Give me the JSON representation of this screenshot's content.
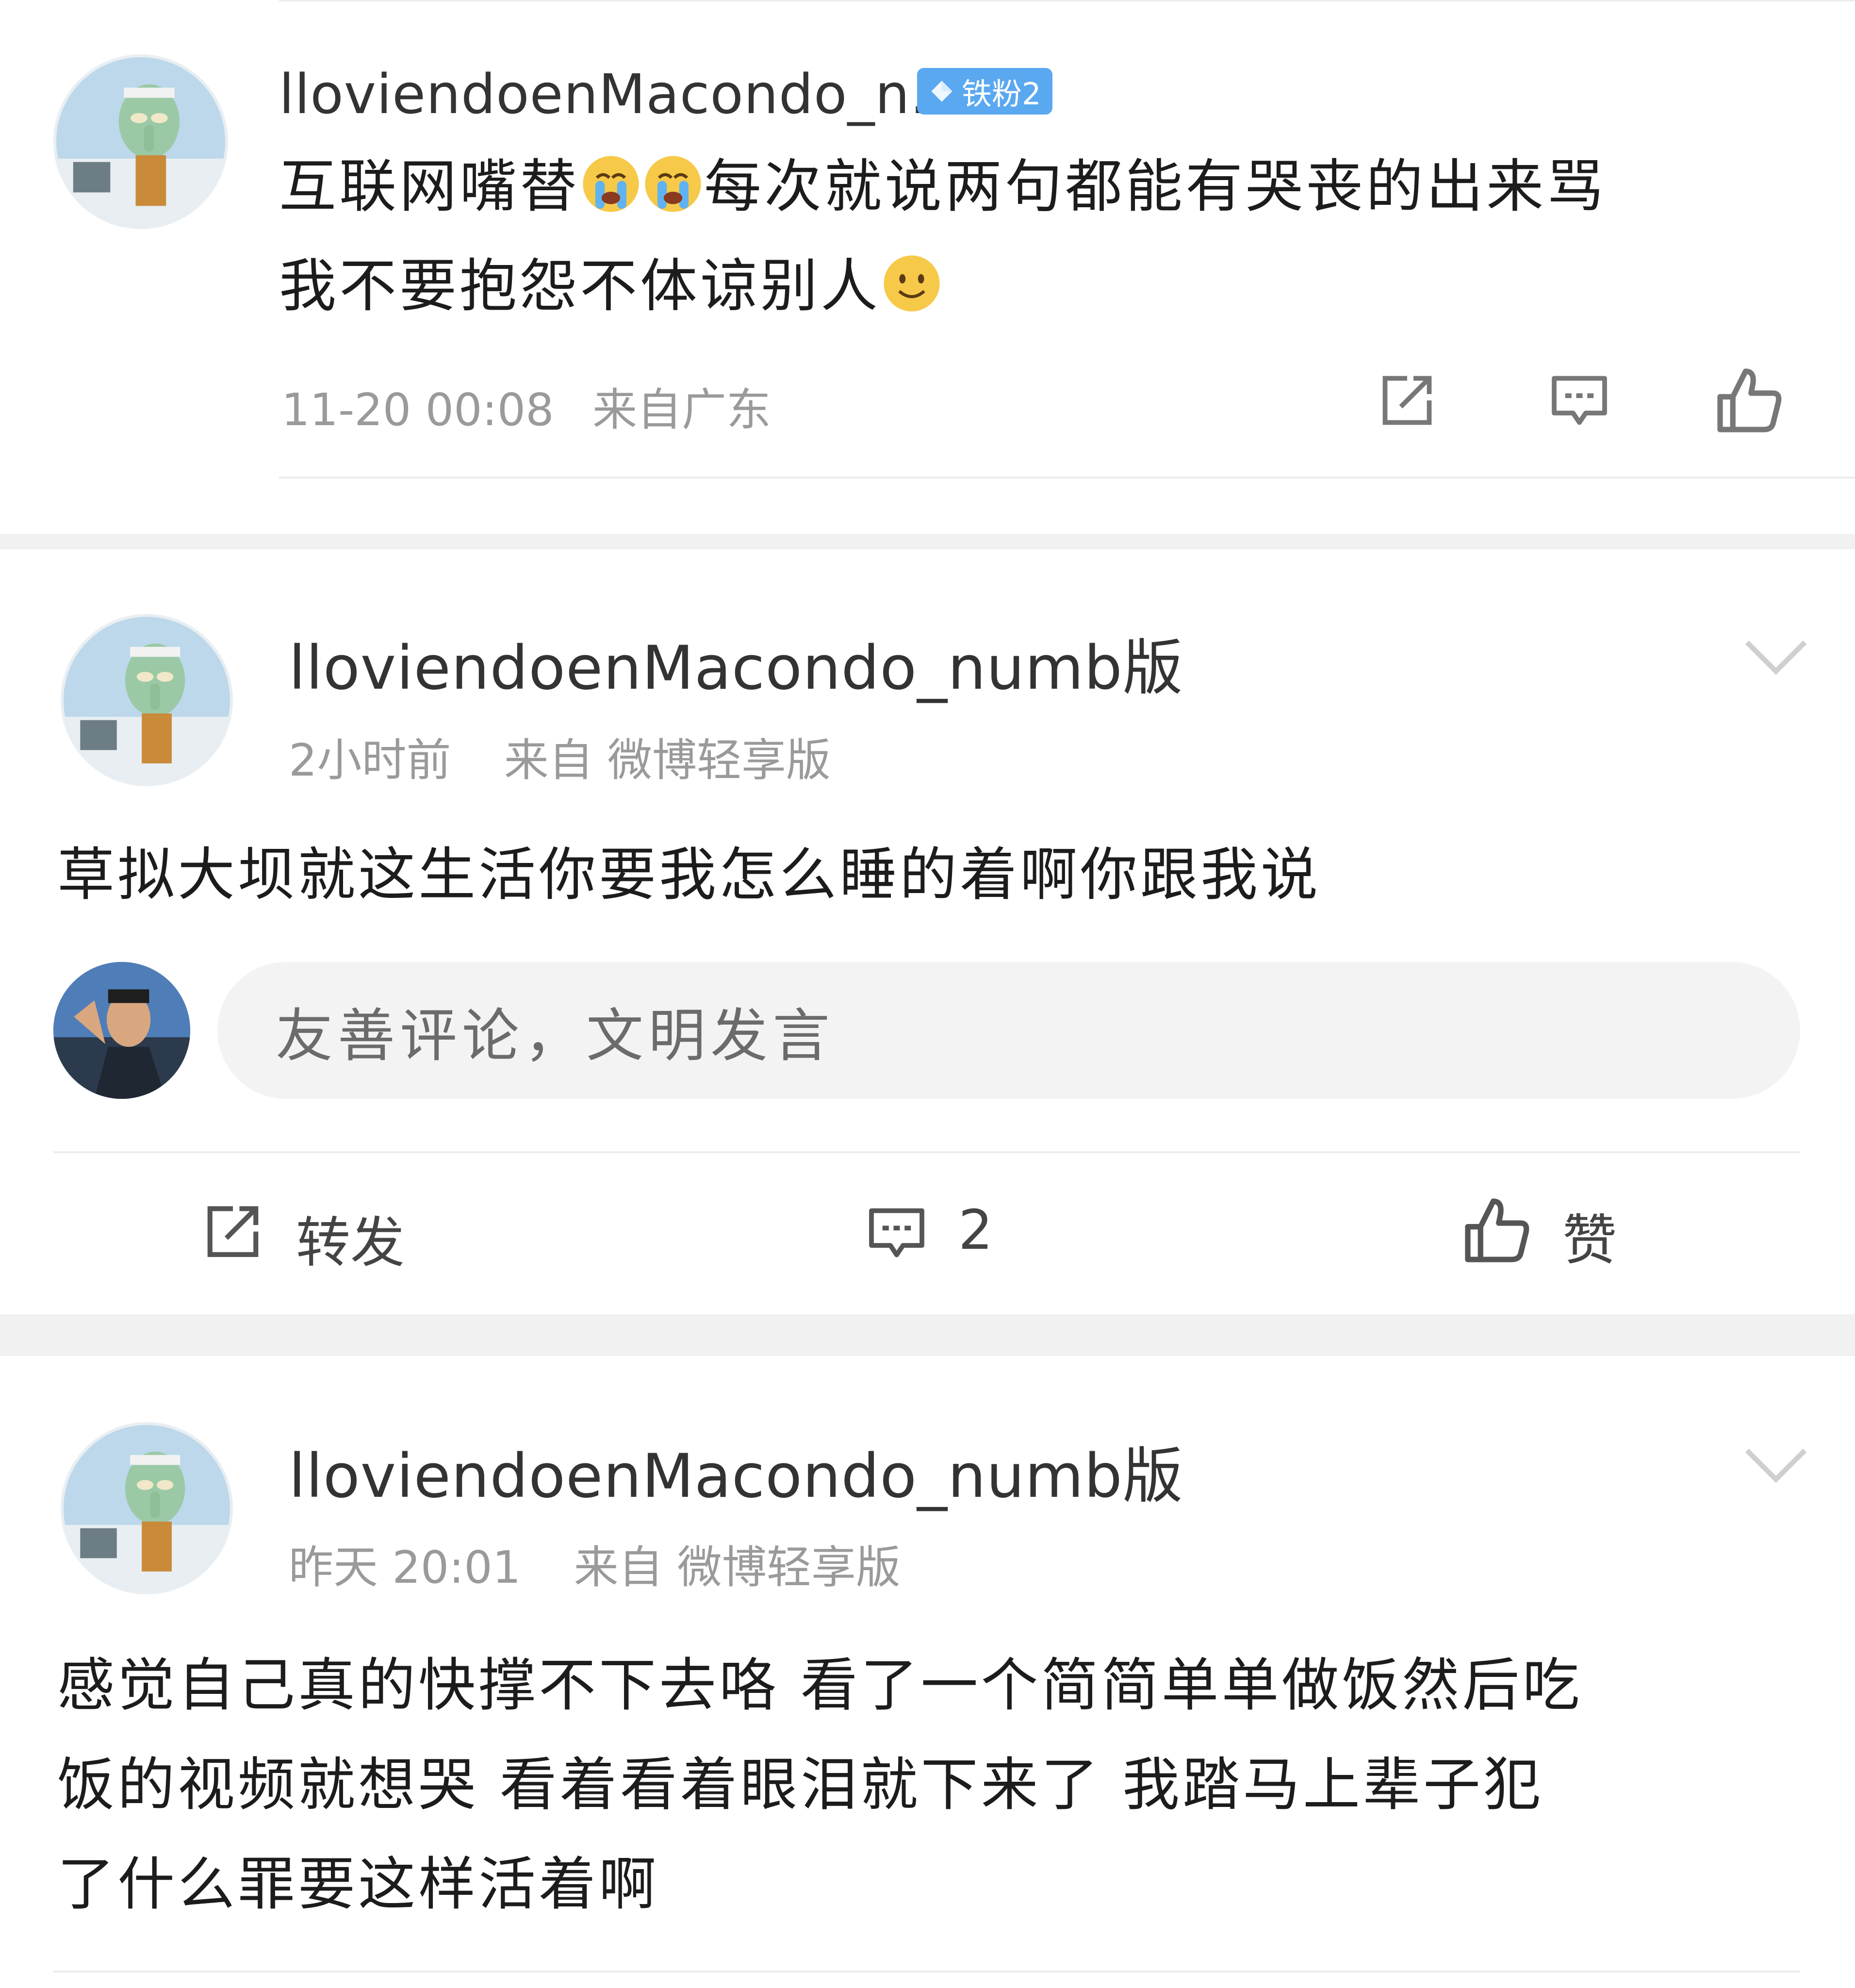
{
  "reply": {
    "username": "lloviendoenMacondo_n...",
    "badge": "铁粉2",
    "text_line1_a": "互联网嘴替",
    "text_line1_b": "每次就说两句都能有哭丧的出来骂",
    "text_line2": "我不要抱怨不体谅别人",
    "emojis": [
      "crying-face",
      "crying-face",
      "smiling-face"
    ],
    "time": "11-20 00:08",
    "location": "来自广东"
  },
  "post1": {
    "username": "lloviendoenMacondo_numb版",
    "time": "2小时前",
    "source": "来自 微博轻享版",
    "text": "草拟大坝就这生活你要我怎么睡的着啊你跟我说",
    "comment_placeholder": "友善评论，文明发言",
    "repost_label": "转发",
    "comment_count": "2",
    "like_label": "赞"
  },
  "post2": {
    "username": "lloviendoenMacondo_numb版",
    "time": "昨天 20:01",
    "source": "来自 微博轻享版",
    "text_line1": "感觉自己真的快撑不下去咯 看了一个简简单单做饭然后吃",
    "text_line2": "饭的视频就想哭 看着看着眼泪就下来了 我踏马上辈子犯",
    "text_line3": "了什么罪要这样活着啊"
  },
  "colors": {
    "badge": "#5aa8f0",
    "meta": "#9a9a9a",
    "separator": "#f1f1f1"
  }
}
